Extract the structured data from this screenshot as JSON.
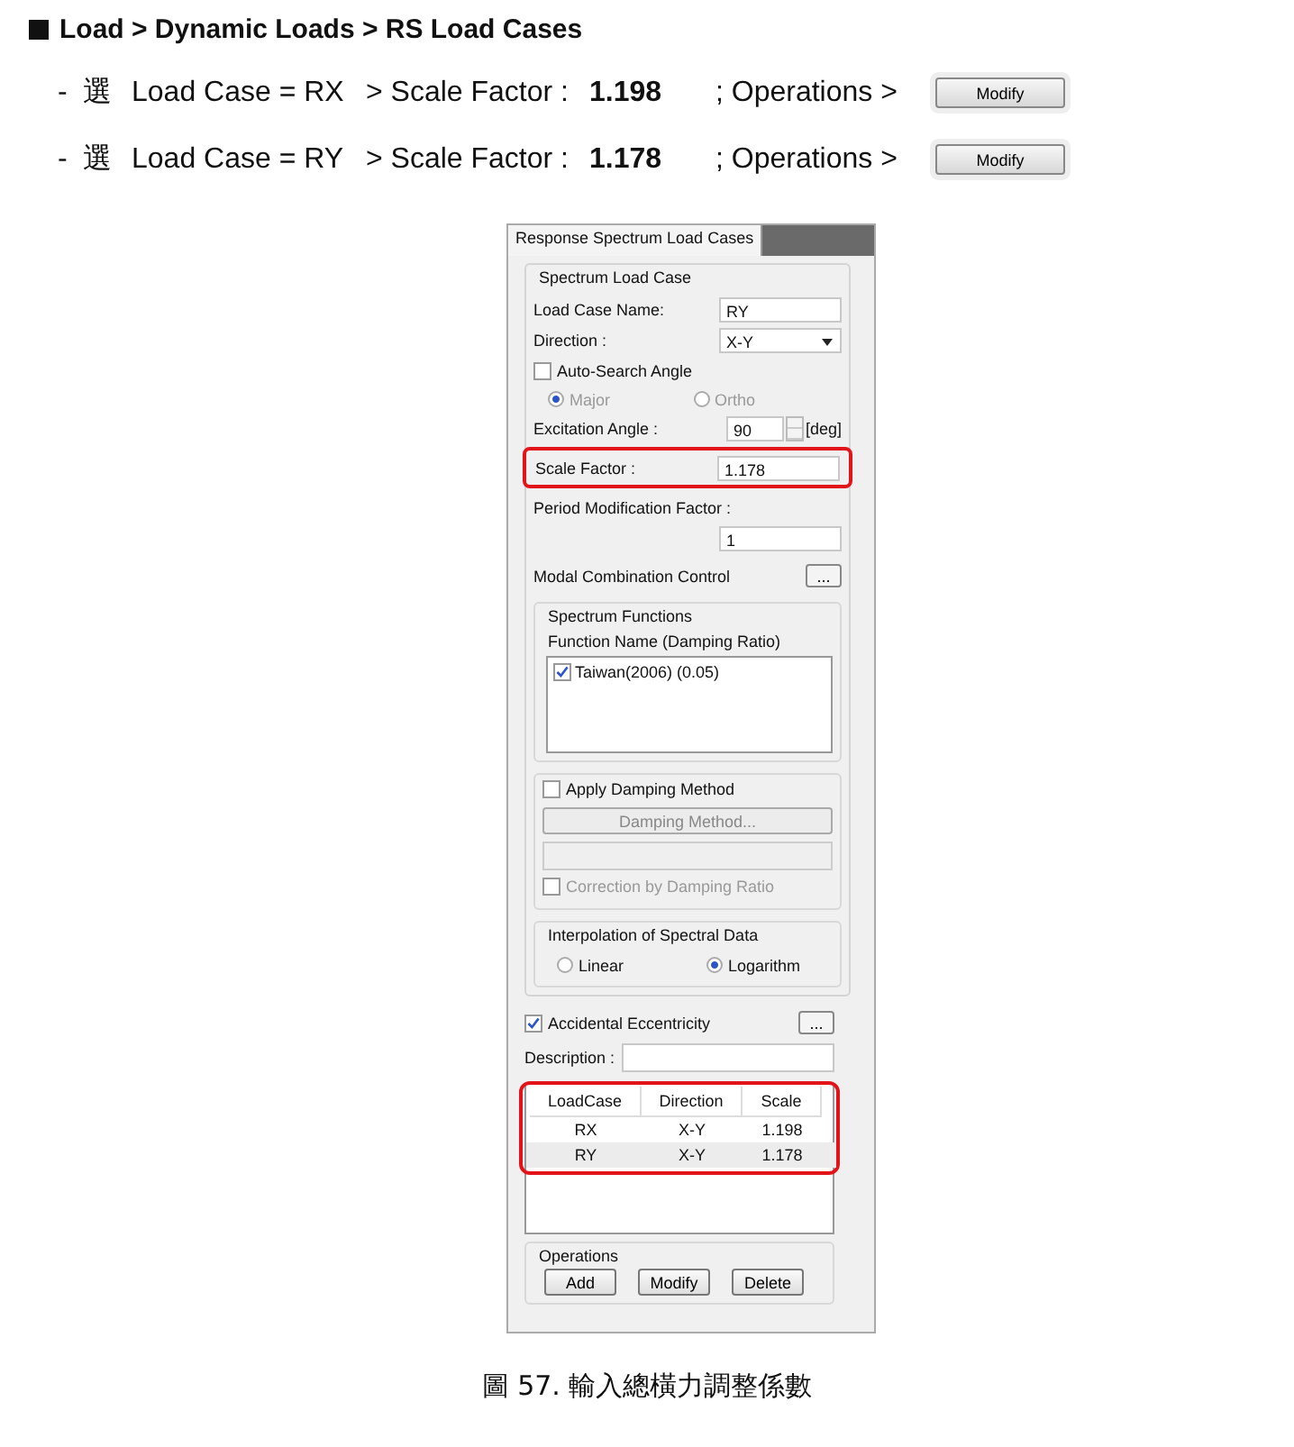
{
  "heading": "Load > Dynamic Loads > RS Load Cases",
  "steps": [
    {
      "bullet": "-",
      "select": "選",
      "load_case": "Load Case = RX",
      "scale_label": "> Scale Factor :",
      "scale_value": "1.198",
      "operations": "; Operations >",
      "button": "Modify"
    },
    {
      "bullet": "-",
      "select": "選",
      "load_case": "Load Case = RY",
      "scale_label": "> Scale Factor :",
      "scale_value": "1.178",
      "operations": "; Operations >",
      "button": "Modify"
    }
  ],
  "dialog": {
    "tab": "Response Spectrum Load Cases",
    "group_title": "Spectrum Load Case",
    "load_case_name": {
      "label": "Load Case Name:",
      "value": "RY"
    },
    "direction": {
      "label": "Direction :",
      "value": "X-Y"
    },
    "auto_search": {
      "label": "Auto-Search Angle",
      "checked": false
    },
    "angle_options": [
      {
        "label": "Major",
        "selected": true
      },
      {
        "label": "Ortho",
        "selected": false
      }
    ],
    "excitation_angle": {
      "label": "Excitation Angle :",
      "value": "90",
      "unit": "[deg]"
    },
    "scale_factor": {
      "label": "Scale Factor :",
      "value": "1.178",
      "highlighted": true
    },
    "period_modification": {
      "label": "Period Modification Factor :",
      "value": "1"
    },
    "modal_combination": {
      "label": "Modal Combination Control",
      "button": "..."
    },
    "spectrum_functions": {
      "title": "Spectrum Functions",
      "column": "Function Name (Damping Ratio)",
      "items": [
        {
          "label": "Taiwan(2006) (0.05)",
          "checked": true
        }
      ]
    },
    "damping": {
      "label": "Apply Damping Method",
      "checked": false,
      "button": "Damping Method...",
      "correction": {
        "label": "Correction by Damping Ratio",
        "checked": false
      }
    },
    "interpolation": {
      "title": "Interpolation of Spectral Data",
      "options": [
        {
          "label": "Linear",
          "selected": false
        },
        {
          "label": "Logarithm",
          "selected": true
        }
      ]
    },
    "accidental": {
      "label": "Accidental Eccentricity",
      "checked": true,
      "button": "..."
    },
    "description": {
      "label": "Description :"
    },
    "table": {
      "highlighted": true,
      "columns": [
        "LoadCase",
        "Direction",
        "Scale"
      ],
      "rows": [
        {
          "cells": [
            "RX",
            "X-Y",
            "1.198"
          ],
          "selected": false
        },
        {
          "cells": [
            "RY",
            "X-Y",
            "1.178"
          ],
          "selected": true
        }
      ]
    },
    "operations": {
      "title": "Operations",
      "buttons": [
        "Add",
        "Modify",
        "Delete"
      ]
    }
  },
  "caption": "圖 57.  輸入總橫力調整係數"
}
